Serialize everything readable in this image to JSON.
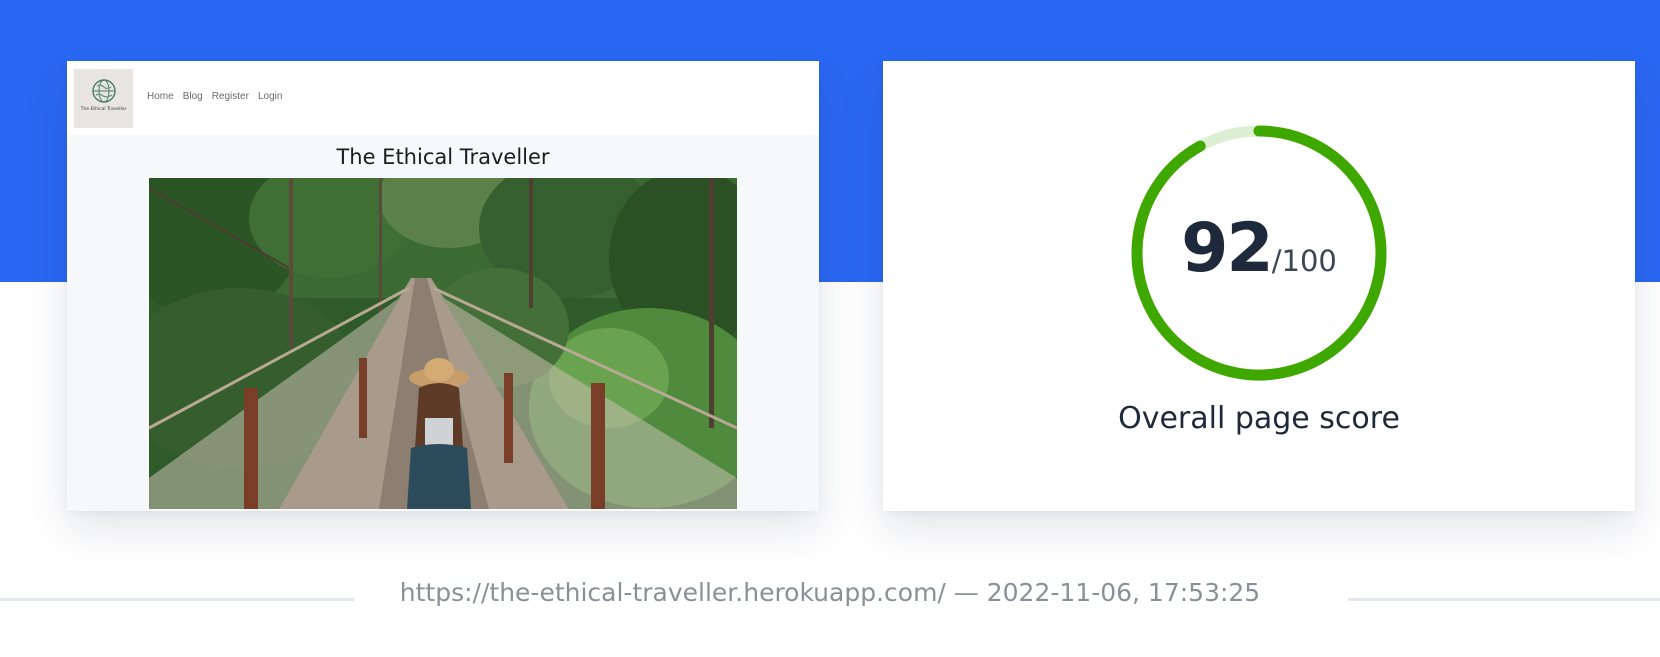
{
  "site_preview": {
    "logo_text": "The Ethical Traveller",
    "nav": [
      "Home",
      "Blog",
      "Register",
      "Login"
    ],
    "title": "The Ethical Traveller"
  },
  "score": {
    "value": "92",
    "max": "/100",
    "fraction": 0.92,
    "label": "Overall page score",
    "color": "#3fa800",
    "track_color": "#dcefd2"
  },
  "footer": {
    "text": "https://the-ethical-traveller.herokuapp.com/ — 2022-11-06, 17:53:25"
  },
  "colors": {
    "accent": "#2a67f2"
  }
}
